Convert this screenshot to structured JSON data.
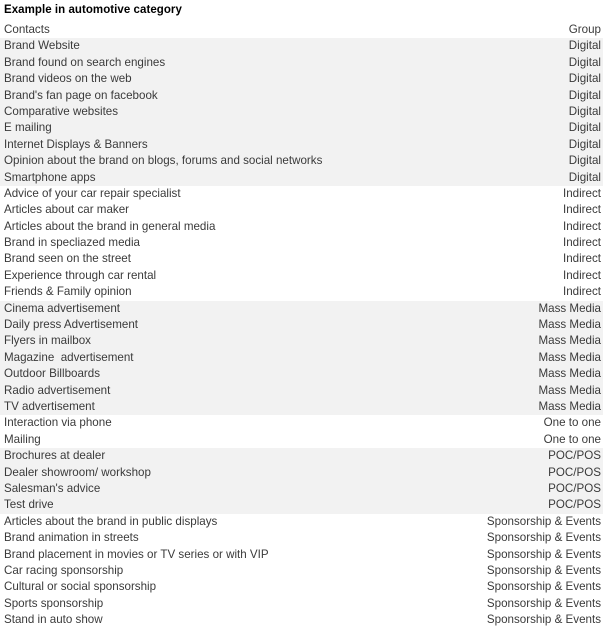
{
  "document": {
    "title": "Example in automotive category"
  },
  "table": {
    "header": {
      "contact": "Contacts",
      "group": "Group"
    },
    "rows": [
      {
        "contact": "Brand Website",
        "group": "Digital",
        "shaded": true
      },
      {
        "contact": "Brand found on search engines",
        "group": "Digital",
        "shaded": true
      },
      {
        "contact": "Brand videos on the web",
        "group": "Digital",
        "shaded": true
      },
      {
        "contact": "Brand's fan page on facebook",
        "group": "Digital",
        "shaded": true
      },
      {
        "contact": "Comparative websites",
        "group": "Digital",
        "shaded": true
      },
      {
        "contact": "E mailing",
        "group": "Digital",
        "shaded": true
      },
      {
        "contact": "Internet Displays & Banners",
        "group": "Digital",
        "shaded": true
      },
      {
        "contact": "Opinion about the brand on blogs, forums and social networks",
        "group": "Digital",
        "shaded": true
      },
      {
        "contact": "Smartphone apps",
        "group": "Digital",
        "shaded": true
      },
      {
        "contact": "Advice of your car repair specialist",
        "group": "Indirect",
        "shaded": false
      },
      {
        "contact": "Articles about car maker",
        "group": "Indirect",
        "shaded": false
      },
      {
        "contact": "Articles about the brand in general media",
        "group": "Indirect",
        "shaded": false
      },
      {
        "contact": "Brand in specliazed media",
        "group": "Indirect",
        "shaded": false
      },
      {
        "contact": "Brand seen on the street",
        "group": "Indirect",
        "shaded": false
      },
      {
        "contact": "Experience through car rental",
        "group": "Indirect",
        "shaded": false
      },
      {
        "contact": "Friends & Family opinion",
        "group": "Indirect",
        "shaded": false
      },
      {
        "contact": "Cinema advertisement",
        "group": "Mass Media",
        "shaded": true
      },
      {
        "contact": "Daily press Advertisement",
        "group": "Mass Media",
        "shaded": true
      },
      {
        "contact": "Flyers in mailbox",
        "group": "Mass Media",
        "shaded": true
      },
      {
        "contact": "Magazine  advertisement",
        "group": "Mass Media",
        "shaded": true
      },
      {
        "contact": "Outdoor Billboards",
        "group": "Mass Media",
        "shaded": true
      },
      {
        "contact": "Radio advertisement",
        "group": "Mass Media",
        "shaded": true
      },
      {
        "contact": "TV advertisement",
        "group": "Mass Media",
        "shaded": true
      },
      {
        "contact": "Interaction via phone",
        "group": "One to one",
        "shaded": false
      },
      {
        "contact": "Mailing",
        "group": "One to one",
        "shaded": false
      },
      {
        "contact": "Brochures at dealer",
        "group": "POC/POS",
        "shaded": true
      },
      {
        "contact": "Dealer showroom/ workshop",
        "group": "POC/POS",
        "shaded": true
      },
      {
        "contact": "Salesman's advice",
        "group": "POC/POS",
        "shaded": true
      },
      {
        "contact": "Test drive",
        "group": "POC/POS",
        "shaded": true
      },
      {
        "contact": "Articles about the brand in public displays",
        "group": "Sponsorship & Events",
        "shaded": false
      },
      {
        "contact": "Brand animation in streets",
        "group": "Sponsorship & Events",
        "shaded": false
      },
      {
        "contact": "Brand placement in movies or TV series or with VIP",
        "group": "Sponsorship & Events",
        "shaded": false
      },
      {
        "contact": "Car racing sponsorship",
        "group": "Sponsorship & Events",
        "shaded": false
      },
      {
        "contact": "Cultural or social sponsorship",
        "group": "Sponsorship & Events",
        "shaded": false
      },
      {
        "contact": "Sports sponsorship",
        "group": "Sponsorship & Events",
        "shaded": false
      },
      {
        "contact": "Stand in auto show",
        "group": "Sponsorship & Events",
        "shaded": false
      }
    ]
  },
  "colors": {
    "shaded_row": "#f2f2f2",
    "plain_row": "#ffffff",
    "body_text": "#3a3a3a",
    "title_text": "#000000"
  }
}
